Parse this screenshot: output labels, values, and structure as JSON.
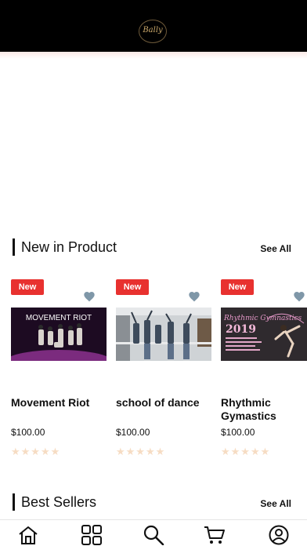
{
  "brand": {
    "logo_text": "Bally",
    "icon": "brand-logo-icon"
  },
  "sections": {
    "new_in_product": {
      "title": "New in Product",
      "see_all": "See All"
    },
    "best_sellers": {
      "title": "Best Sellers",
      "see_all": "See All"
    }
  },
  "products": [
    {
      "badge": "New",
      "name": "Movement Riot",
      "price": "$100.00",
      "stars": "★★★★★",
      "image_text": "MOVEMENT RIOT",
      "rating": 0,
      "wishlist_icon": "heart-icon"
    },
    {
      "badge": "New",
      "name": "school of dance",
      "price": "$100.00",
      "stars": "★★★★★",
      "rating": 0,
      "wishlist_icon": "heart-icon"
    },
    {
      "badge": "New",
      "name": "Rhythmic Gymastics",
      "price": "$100.00",
      "stars": "★★★★★",
      "image_text": "Rhythmic Gymnastics",
      "rating": 0,
      "wishlist_icon": "heart-icon"
    }
  ],
  "bottom_nav": [
    {
      "icon": "home-icon"
    },
    {
      "icon": "categories-grid-icon"
    },
    {
      "icon": "search-icon"
    },
    {
      "icon": "cart-icon"
    },
    {
      "icon": "profile-icon"
    }
  ],
  "colors": {
    "badge": "#e8312f",
    "heart": "#7f97a8",
    "star_empty": "#f6dcc3",
    "header_bg": "#000000"
  }
}
